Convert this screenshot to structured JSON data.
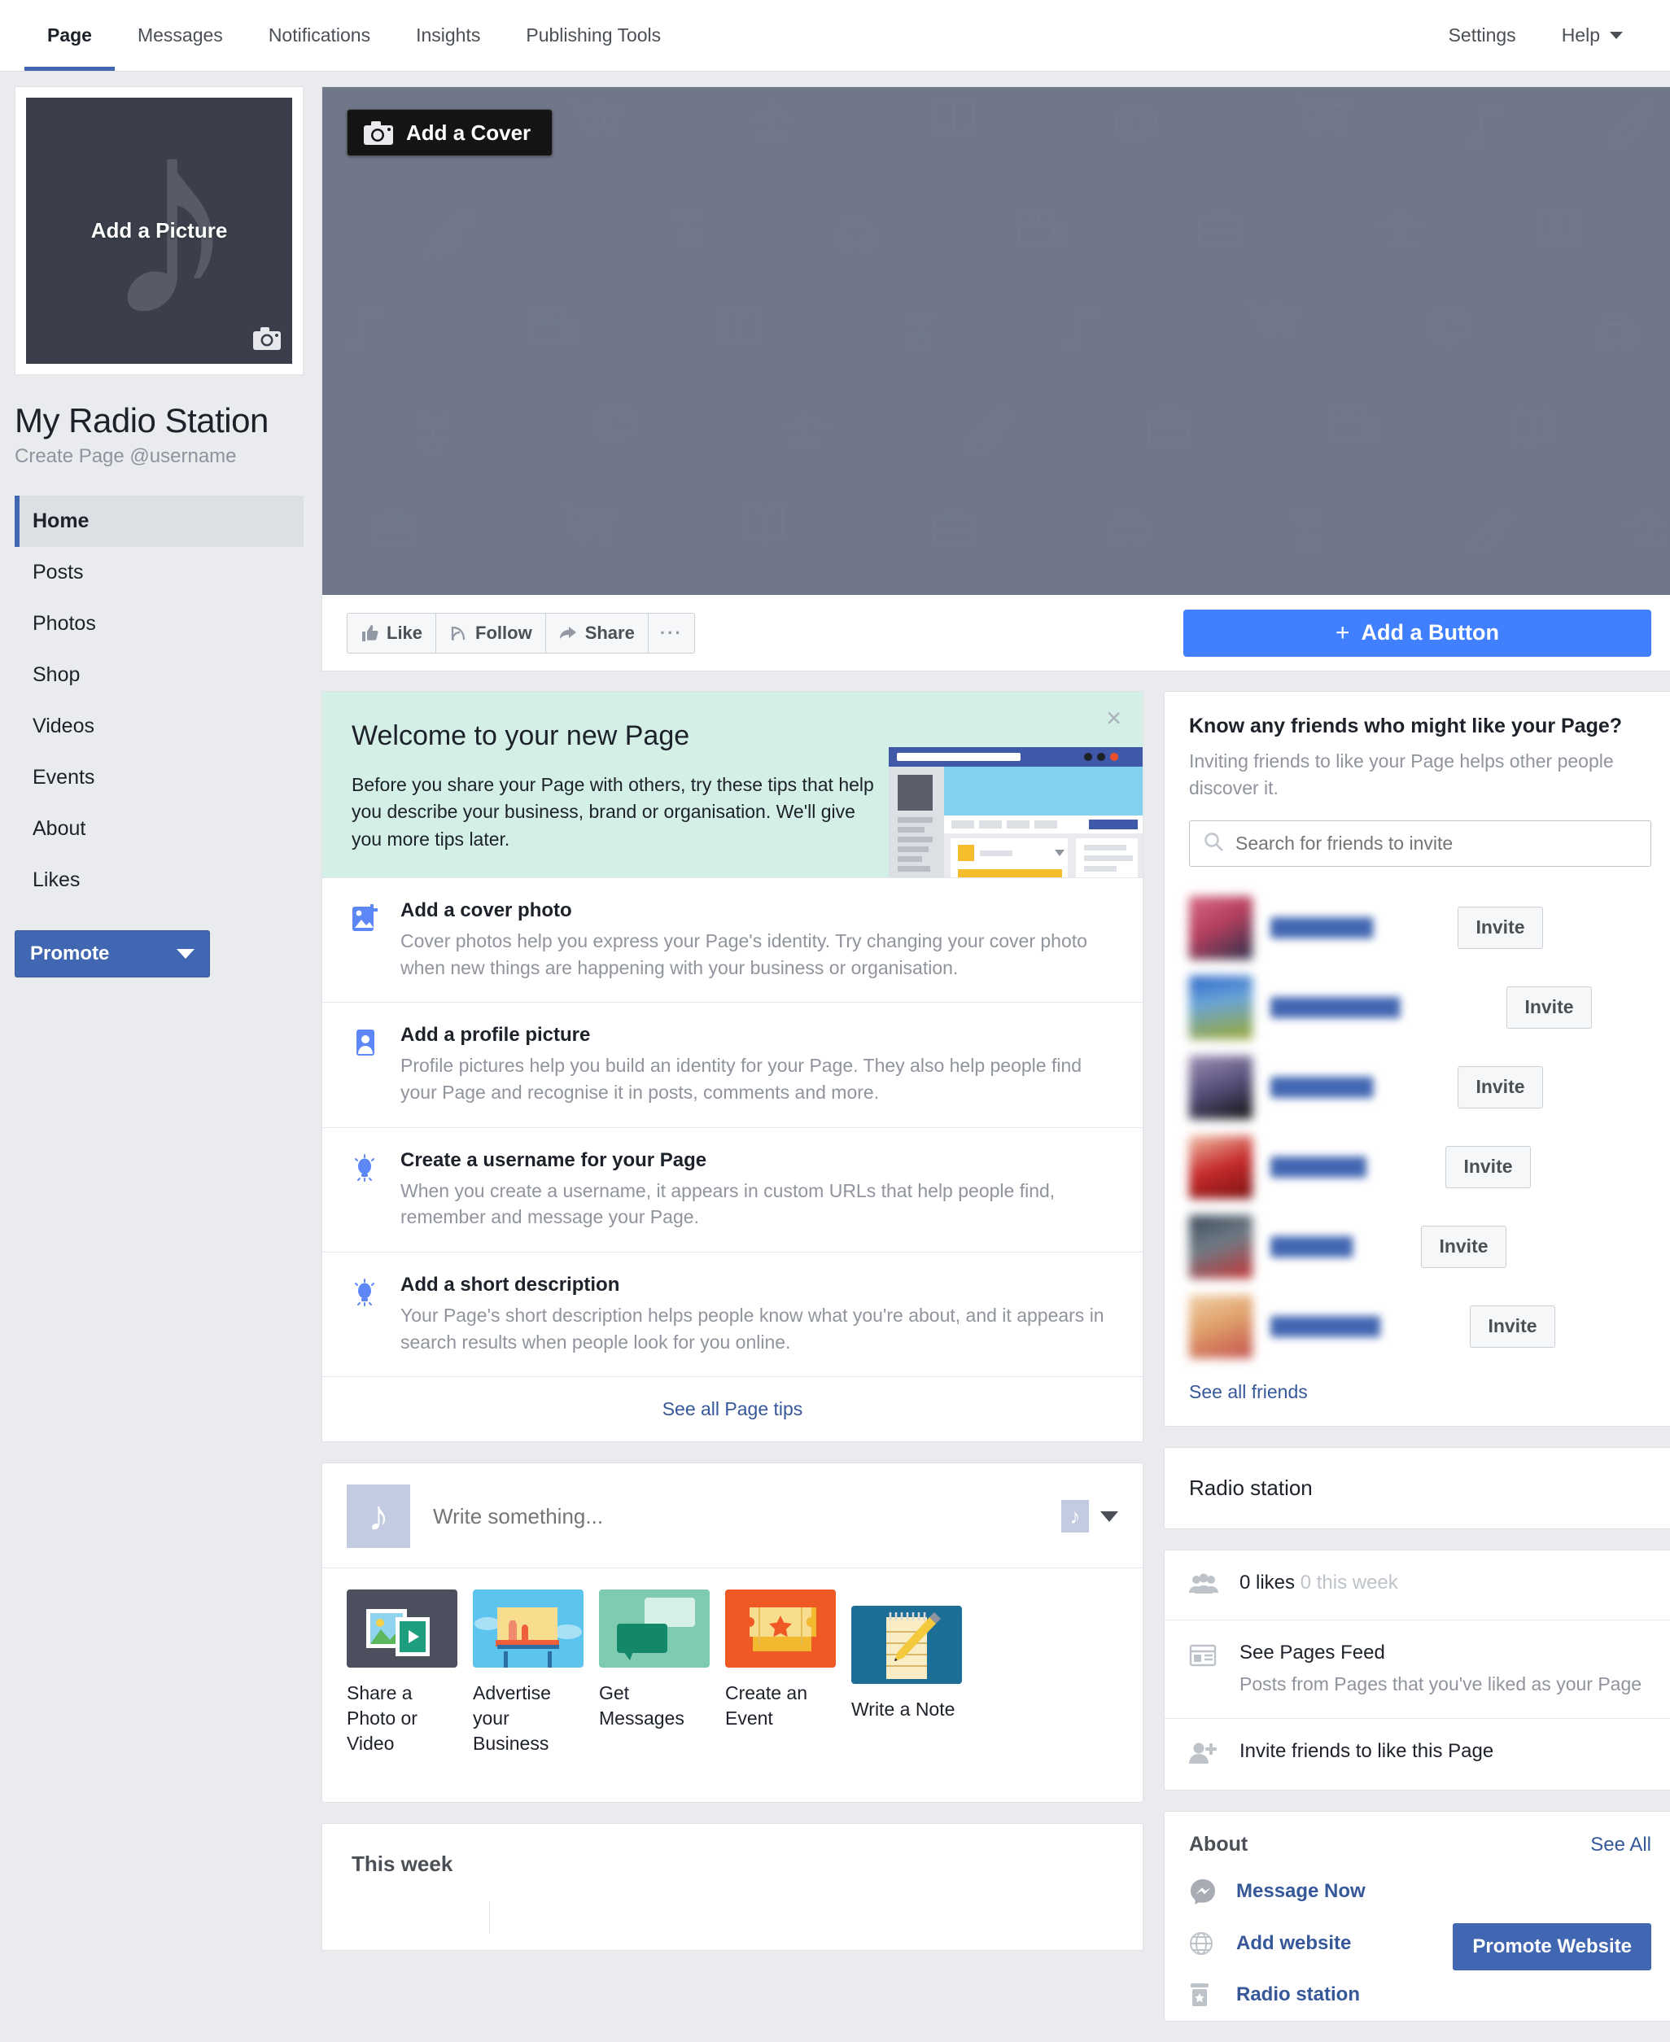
{
  "topnav": {
    "tabs": [
      {
        "label": "Page",
        "active": true
      },
      {
        "label": "Messages",
        "active": false
      },
      {
        "label": "Notifications",
        "active": false
      },
      {
        "label": "Insights",
        "active": false
      },
      {
        "label": "Publishing Tools",
        "active": false
      }
    ],
    "right": [
      {
        "label": "Settings",
        "caret": false
      },
      {
        "label": "Help",
        "caret": true
      }
    ]
  },
  "profile": {
    "add_picture_label": "Add a Picture",
    "camera_icon": "camera-icon",
    "note_glyph": "♪",
    "title": "My Radio Station",
    "subtitle": "Create Page @username"
  },
  "sidebar": {
    "items": [
      {
        "label": "Home",
        "active": true
      },
      {
        "label": "Posts",
        "active": false
      },
      {
        "label": "Photos",
        "active": false
      },
      {
        "label": "Shop",
        "active": false
      },
      {
        "label": "Videos",
        "active": false
      },
      {
        "label": "Events",
        "active": false
      },
      {
        "label": "About",
        "active": false
      },
      {
        "label": "Likes",
        "active": false
      }
    ],
    "promote_label": "Promote"
  },
  "cover": {
    "add_cover_label": "Add a Cover",
    "background_color": "#6f7789"
  },
  "actionbar": {
    "like_label": "Like",
    "follow_label": "Follow",
    "share_label": "Share",
    "more_label": "···",
    "add_button_label": "Add a Button",
    "add_button_plus": "+",
    "add_button_color": "#4080ff"
  },
  "welcome": {
    "title": "Welcome to your new Page",
    "body": "Before you share your Page with others, try these tips that help you describe your business, brand or organisation. We'll give you more tips later.",
    "close_label": "×",
    "background_color": "#d3efe6",
    "tips": [
      {
        "icon": "add-photo-icon",
        "title": "Add a cover photo",
        "desc": "Cover photos help you express your Page's identity. Try changing your cover photo when new things are happening with your business or organisation."
      },
      {
        "icon": "profile-picture-icon",
        "title": "Add a profile picture",
        "desc": "Profile pictures help you build an identity for your Page. They also help people find your Page and recognise it in posts, comments and more."
      },
      {
        "icon": "lightbulb-icon",
        "title": "Create a username for your Page",
        "desc": "When you create a username, it appears in custom URLs that help people find, remember and message your Page."
      },
      {
        "icon": "lightbulb-icon",
        "title": "Add a short description",
        "desc": "Your Page's short description helps people know what you're about, and it appears in search results when people look for you online."
      }
    ],
    "see_all_label": "See all Page tips"
  },
  "composer": {
    "placeholder": "Write something...",
    "avatar_glyph": "♪",
    "mini_glyph": "♪",
    "tiles": [
      {
        "label": "Share a Photo or Video",
        "icon": "photo-video-icon",
        "color": "#4b4f5e"
      },
      {
        "label": "Advertise your Business",
        "icon": "billboard-icon",
        "color": "#5cc4ee"
      },
      {
        "label": "Get Messages",
        "icon": "messages-icon",
        "color": "#7ecbb0"
      },
      {
        "label": "Create an Event",
        "icon": "ticket-icon",
        "color": "#ef5924"
      },
      {
        "label": "Write a Note",
        "icon": "notepad-icon",
        "color": "#1c6e96"
      }
    ]
  },
  "thisweek": {
    "title": "This week"
  },
  "invite_card": {
    "title": "Know any friends who might like your Page?",
    "subtitle": "Inviting friends to like your Page helps other people discover it.",
    "search_placeholder": "Search for friends to invite",
    "search_icon": "search-icon",
    "friends": [
      {
        "name": "",
        "invite_label": "Invite",
        "avatar_colors": [
          "#d86b84",
          "#2b2f4a"
        ]
      },
      {
        "name": "",
        "invite_label": "Invite",
        "avatar_colors": [
          "#2a66c8",
          "#9aa830"
        ]
      },
      {
        "name": "",
        "invite_label": "Invite",
        "avatar_colors": [
          "#9f8fb5",
          "#1a1a1a"
        ]
      },
      {
        "name": "",
        "invite_label": "Invite",
        "avatar_colors": [
          "#c62b2b",
          "#7a1010"
        ]
      },
      {
        "name": "",
        "invite_label": "Invite",
        "avatar_colors": [
          "#3b4a58",
          "#c43333"
        ]
      },
      {
        "name": "",
        "invite_label": "Invite",
        "avatar_colors": [
          "#e0a16b",
          "#c4524e"
        ]
      }
    ],
    "see_all_label": "See all friends"
  },
  "category_card": {
    "title": "Radio station"
  },
  "stats_card": {
    "likes_value": "0 likes",
    "likes_muted": " 0 this week",
    "likes_icon": "people-icon",
    "pages_feed_title": "See Pages Feed",
    "pages_feed_sub": "Posts from Pages that you've liked as your Page",
    "pages_feed_icon": "feed-icon",
    "invite_friends_label": "Invite friends to like this Page",
    "invite_friends_icon": "add-person-icon"
  },
  "about_card": {
    "title": "About",
    "see_all_label": "See All",
    "message_now_label": "Message Now",
    "message_icon": "messenger-icon",
    "add_website_label": "Add website",
    "website_icon": "globe-icon",
    "category_label": "Radio station",
    "category_icon": "shop-icon",
    "promote_website_label": "Promote Website"
  }
}
